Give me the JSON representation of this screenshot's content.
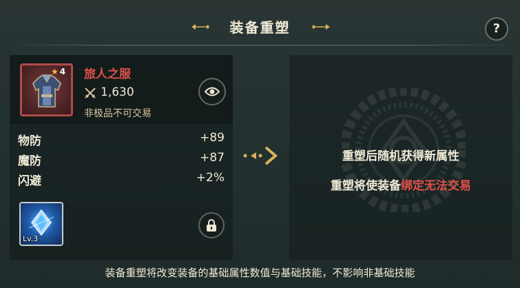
{
  "header": {
    "title": "装备重塑",
    "help_label": "?"
  },
  "item": {
    "star_count": "4",
    "name": "旅人之服",
    "power": "1,630",
    "trade_note": "非极品不可交易",
    "frame_color": "#b14a4a"
  },
  "stats": [
    {
      "name": "物防",
      "value": "+89"
    },
    {
      "name": "魔防",
      "value": "+87"
    },
    {
      "name": "闪避",
      "value": "+2%"
    }
  ],
  "skill": {
    "level": "Lv.3"
  },
  "result": {
    "line1": "重塑后随机获得新属性",
    "line2_prefix": "重塑将使装备",
    "line2_warning": "绑定无法交易"
  },
  "footer": {
    "note": "装备重塑将改变装备的基础属性数值与基础技能，不影响非基础技能"
  },
  "colors": {
    "accent_gold": "#d9b45a",
    "warning_red": "#e2504a",
    "text": "#f0ead6"
  },
  "icons": [
    "ornament-left-icon",
    "ornament-right-icon",
    "help-icon",
    "armor-icon",
    "star-icon",
    "sword-icon",
    "eye-icon",
    "skill-crystal-icon",
    "lock-icon",
    "double-arrow-icon",
    "emblem-icon"
  ]
}
